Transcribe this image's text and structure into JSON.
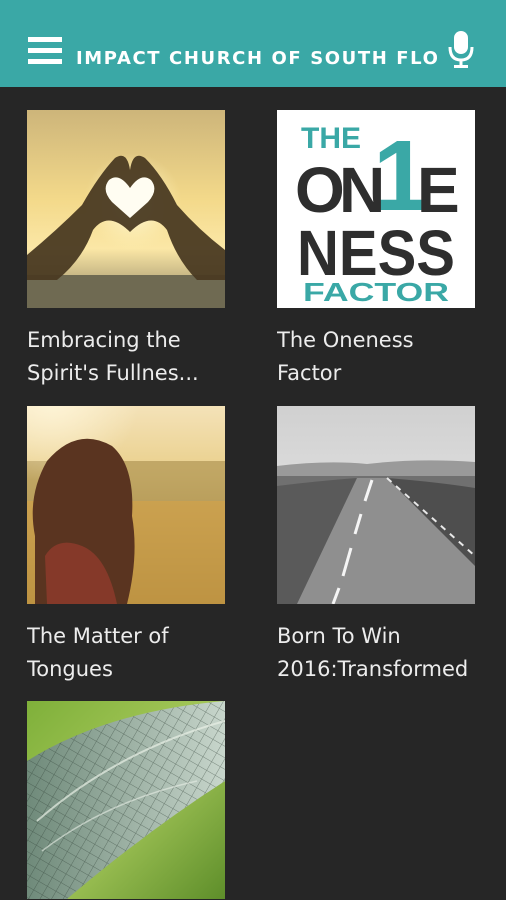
{
  "header": {
    "title": "IMPACT CHURCH OF SOUTH FLO",
    "menu_icon": "hamburger-menu-icon",
    "mic_icon": "microphone-icon",
    "bar_color": "#3aa8a6"
  },
  "items": [
    {
      "line1": "Embracing the",
      "line2": "Spirit's Fullnes..."
    },
    {
      "line1": "The Oneness",
      "line2": "Factor",
      "artwork": {
        "the": "THE",
        "one": "1",
        "o": "O",
        "n": "N",
        "e": "E",
        "ness": "NESS",
        "factor": "FACTOR"
      }
    },
    {
      "line1": "The Matter of",
      "line2": "Tongues"
    },
    {
      "line1": "Born To Win",
      "line2": "2016:Transformed"
    },
    {
      "line1": "",
      "line2": ""
    }
  ],
  "colors": {
    "background": "#262626",
    "caption": "#ececec",
    "oneness_teal": "#3aa8a6",
    "oneness_dark": "#2e2e2e"
  }
}
